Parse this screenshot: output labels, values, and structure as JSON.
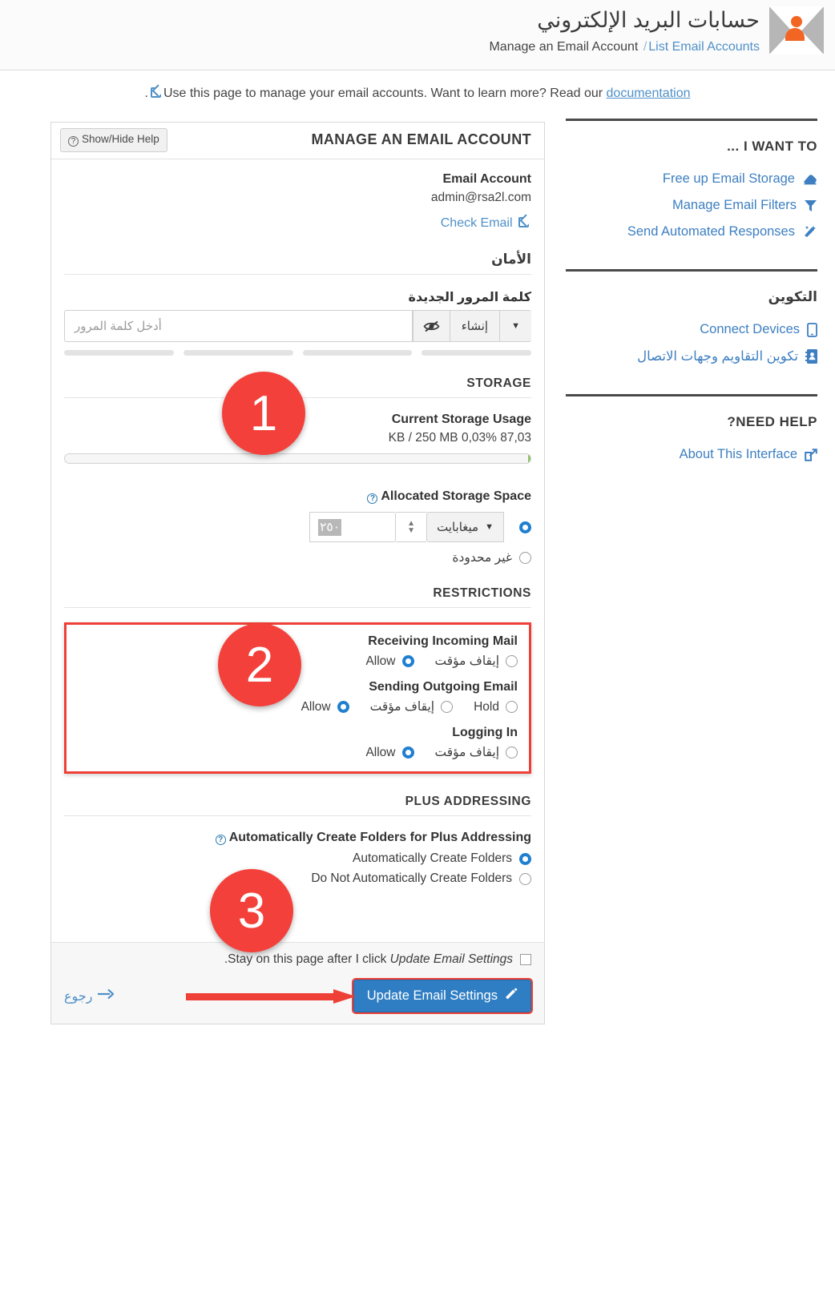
{
  "header": {
    "title_ar": "حسابات البريد الإلكتروني",
    "breadcrumb_current": "Manage an Email Account",
    "breadcrumb_sep": "/",
    "breadcrumb_link": "List Email Accounts",
    "logo_icon": "envelope-person-icon"
  },
  "page_description": {
    "prefix": ".",
    "icon": "external-link-icon",
    "text": "Use this page to manage your email accounts. Want to learn more? Read our",
    "link": "documentation"
  },
  "sidebar": {
    "groups": [
      {
        "heading": "... I WANT TO",
        "heading_dir": "ltr",
        "items": [
          {
            "label": "Free up Email Storage",
            "icon": "eraser-icon",
            "dir": "ltr"
          },
          {
            "label": "Manage Email Filters",
            "icon": "filter-icon",
            "dir": "ltr"
          },
          {
            "label": "Send Automated Responses",
            "icon": "magic-wand-icon",
            "dir": "ltr"
          }
        ]
      },
      {
        "heading": "التكوين",
        "heading_dir": "rtl",
        "items": [
          {
            "label": "Connect Devices",
            "icon": "mobile-device-icon",
            "dir": "ltr"
          },
          {
            "label": "تكوين التقاويم وجهات الاتصال",
            "icon": "address-book-icon",
            "dir": "rtl"
          }
        ]
      },
      {
        "heading": "?NEED HELP",
        "heading_dir": "ltr",
        "items": [
          {
            "label": "About This Interface",
            "icon": "external-link-icon",
            "dir": "ltr"
          }
        ]
      }
    ]
  },
  "panel": {
    "title": "MANAGE AN EMAIL ACCOUNT",
    "show_hide_help": "Show/Hide Help",
    "help_icon": "question-circle-icon",
    "email_account_label": "Email Account",
    "email_account_value": "admin@rsa2l.com",
    "check_email_label": "Check Email",
    "check_email_icon": "external-link-icon"
  },
  "security": {
    "section_title": "الأمان",
    "new_password_label": "كلمة المرور الجديدة",
    "password_placeholder": "أدخل كلمة المرور",
    "password_value": "",
    "generate_label": "إنشاء",
    "eye_icon": "eye-slash-icon",
    "caret_icon": "caret-down-icon",
    "strength_segments": 4
  },
  "storage": {
    "section_title": "STORAGE",
    "current_usage_label": "Current Storage Usage",
    "current_usage_value": "KB / 250 MB 0,03% 87,03",
    "usage_percent": 0.03,
    "allocated_label": "Allocated Storage Space",
    "allocated_help_icon": "question-circle-icon",
    "allocated_value": "٢٥٠",
    "allocated_unit": "ميغابايت",
    "allocated_selected": true,
    "unlimited_label": "غير محدودة",
    "unlimited_selected": false,
    "unit_caret_icon": "caret-down-icon",
    "spinner_icon": "spinner-updown-icon"
  },
  "restrictions": {
    "section_title": "RESTRICTIONS",
    "groups": [
      {
        "title": "Receiving Incoming Mail",
        "options": [
          {
            "label": "إيقاف مؤقت",
            "dir": "rtl",
            "selected": false
          },
          {
            "label": "Allow",
            "dir": "ltr",
            "selected": true
          }
        ]
      },
      {
        "title": "Sending Outgoing Email",
        "options": [
          {
            "label": "Hold",
            "dir": "ltr",
            "selected": false
          },
          {
            "label": "إيقاف مؤقت",
            "dir": "rtl",
            "selected": false
          },
          {
            "label": "Allow",
            "dir": "ltr",
            "selected": true
          }
        ]
      },
      {
        "title": "Logging In",
        "options": [
          {
            "label": "إيقاف مؤقت",
            "dir": "rtl",
            "selected": false
          },
          {
            "label": "Allow",
            "dir": "ltr",
            "selected": true
          }
        ]
      }
    ]
  },
  "plus_addressing": {
    "section_title": "PLUS ADDRESSING",
    "label": "Automatically Create Folders for Plus Addressing",
    "help_icon": "question-circle-icon",
    "options": [
      {
        "label": "Automatically Create Folders",
        "selected": true
      },
      {
        "label": "Do Not Automatically Create Folders",
        "selected": false
      }
    ]
  },
  "footer": {
    "stay_text_before": ".Stay on this page after I click ",
    "stay_text_em": "Update Email Settings",
    "stay_checked": false,
    "update_button": "Update Email Settings",
    "update_icon": "pencil-icon",
    "back_label": "رجوع",
    "back_icon": "arrow-right-icon"
  },
  "annotations": {
    "badges": [
      "1",
      "2",
      "3"
    ],
    "accent_red": "#f4403a",
    "accent_blue": "#2f7ec4",
    "link_blue": "#4f90c8"
  }
}
